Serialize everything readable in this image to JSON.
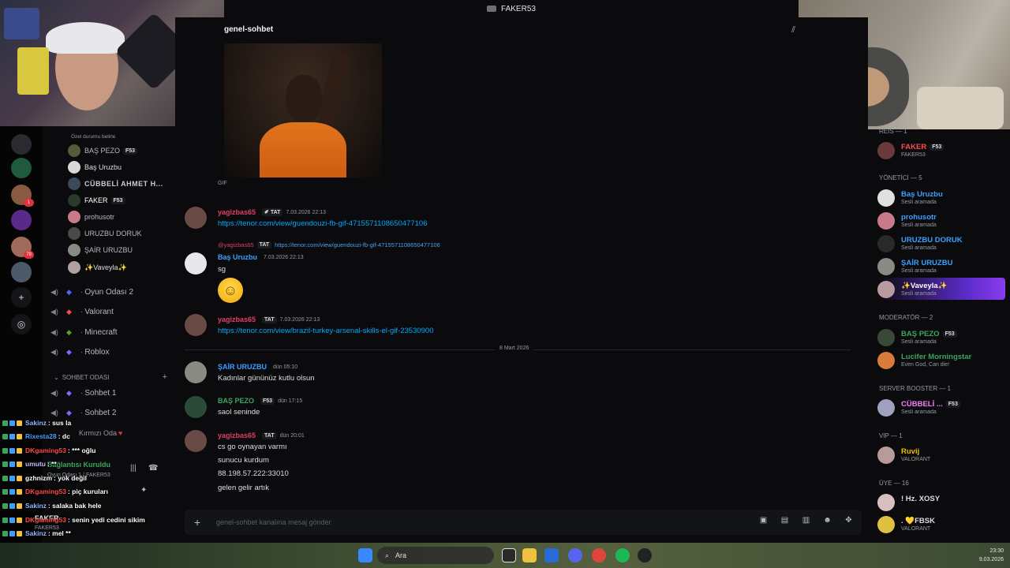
{
  "window": {
    "title": "FAKER53"
  },
  "channel": {
    "name": "genel-sohbet",
    "placeholder": "genel-sohbet kanalına mesaj gönder"
  },
  "voice_users": [
    {
      "name": "BAŞ PEZO",
      "tag": "F53",
      "color": "#b5bac1"
    },
    {
      "name": "Baş Uruzbu",
      "tag": "",
      "color": "#dbdee1"
    },
    {
      "name": "CÜBBELİ AHMET H...",
      "tag": "",
      "color": "#c9ccd2"
    },
    {
      "name": "FAKER",
      "tag": "F53",
      "color": "#ffffff"
    },
    {
      "name": "prohusotr",
      "tag": "",
      "color": "#b5bac1"
    },
    {
      "name": "URUZBU DORUK",
      "tag": "",
      "color": "#b5bac1"
    },
    {
      "name": "ŞAİR URUZBU",
      "tag": "",
      "color": "#b5bac1"
    },
    {
      "name": "✨Vaveyla✨",
      "tag": "",
      "color": "#dbdee1"
    }
  ],
  "voice_channels": [
    {
      "name": "Oyun Odası 2"
    },
    {
      "name": "Valorant"
    },
    {
      "name": "Minecraft"
    },
    {
      "name": "Roblox"
    }
  ],
  "category": {
    "name": "SOHBET ODASI"
  },
  "sohbet_channels": [
    {
      "name": "Sohbet 1"
    },
    {
      "name": "Sohbet 2"
    }
  ],
  "stream_chat": [
    {
      "user": "Sakinz",
      "text": ": sus la",
      "color": "#8fb8ff"
    },
    {
      "user": "Rixesta28",
      "text": ": dc",
      "color": "#4aa0ff"
    },
    {
      "user": "DKgaming53",
      "text": ": *** oğlu",
      "color": "#ff4a4a"
    },
    {
      "user": "umutu",
      "text": ": **",
      "color": "#c8b4ff"
    },
    {
      "user": "gzhnizm",
      "text": ": yok değil",
      "color": "#ffffff"
    },
    {
      "user": "DKgaming53",
      "text": ": piç kuruları",
      "color": "#ff4a4a"
    },
    {
      "user": "Sakinz",
      "text": ": salaka bak hele",
      "color": "#8fb8ff"
    },
    {
      "user": "DKgaming53",
      "text": ": senin yedi cedini sikim",
      "color": "#ff4a4a"
    },
    {
      "user": "Sakinz",
      "text": ": mel **",
      "color": "#8fb8ff"
    }
  ],
  "sidebar_overlay": {
    "status_hint": "Özel durumu belirle",
    "red_room": "Kırmızı Oda",
    "connection": "Bağlantısı Kuruldu",
    "connection_sub": "Oyun Odası 1 / FAKER53",
    "user": "FAKER",
    "user_sub": "FAKER53"
  },
  "gif_label": "GIF",
  "messages": [
    {
      "user": "yagizbas65",
      "tag": "TAT",
      "time": "7.03.2026 22:13",
      "link": "https://tenor.com/view/guendouzi-fb-gif-4715571108650477106"
    },
    {
      "reply_user": "@yagizbas65",
      "reply_tag": "TAT",
      "reply_link": "https://tenor.com/view/guendouzi-fb-gif-4715571108650477106",
      "user": "Baş Uruzbu",
      "time": "7.03.2026 22:13",
      "text": "sg"
    },
    {
      "user": "yagizbas65",
      "tag": "TAT",
      "time": "7.03.2026 22:13",
      "link": "https://tenor.com/view/brazil-turkey-arsenal-skills-el-gif-23530900"
    },
    {
      "user": "ŞAİR URUZBU",
      "time": "dün 05:10",
      "text": "Kadınlar gününüz kutlu olsun"
    },
    {
      "user": "BAŞ PEZO",
      "tag": "F53",
      "time": "dün 17:15",
      "text": "saol seninde"
    },
    {
      "user": "yagizbas65",
      "tag": "TAT",
      "time": "dün 20:01",
      "lines": [
        "cs go oynayan varmı",
        "sunucu kurdum",
        "88.198.57.222:33010",
        "gelen gelir artık"
      ]
    }
  ],
  "date_divider": "8 Mart 2026",
  "members": {
    "reis": {
      "label": "REİS — 1",
      "items": [
        {
          "name": "FAKER",
          "tag": "F53",
          "sub": "FAKER53",
          "color": "#ff4a4a"
        }
      ]
    },
    "yonetici": {
      "label": "YÖNETİCİ — 5",
      "items": [
        {
          "name": "Baş Uruzbu",
          "sub": "Sesli aramada",
          "color": "#3aa0ff"
        },
        {
          "name": "prohusotr",
          "sub": "Sesli aramada",
          "color": "#3aa0ff"
        },
        {
          "name": "URUZBU DORUK",
          "sub": "Sesli aramada",
          "color": "#3aa0ff"
        },
        {
          "name": "ŞAİR URUZBU",
          "sub": "Sesli aramada",
          "color": "#3aa0ff"
        },
        {
          "name": "✨Vaveyla✨",
          "sub": "Sesli aramada",
          "color": "#ffffff"
        }
      ]
    },
    "moderator": {
      "label": "MODERATÖR — 2",
      "items": [
        {
          "name": "BAŞ PEZO",
          "tag": "F53",
          "sub": "Sesli aramada",
          "color": "#3ba55d"
        },
        {
          "name": "Lucifer Morningstar",
          "sub": "Even God, Can die!",
          "color": "#3ba55d"
        }
      ]
    },
    "booster": {
      "label": "Server Booster — 1",
      "items": [
        {
          "name": "CÜBBELİ ...",
          "tag": "F53",
          "sub": "Sesli aramada",
          "color": "#f47fff"
        }
      ]
    },
    "vip": {
      "label": "VIP — 1",
      "items": [
        {
          "name": "Ruvij",
          "sub": "VALORANT",
          "color": "#f0c000"
        }
      ]
    },
    "uye": {
      "label": "Üye — 16",
      "items": [
        {
          "name": "! Hz. XOSY",
          "sub": "",
          "color": "#dbdee1"
        },
        {
          "name": ". 💛FBSK",
          "sub": "VALORANT",
          "color": "#dbdee1"
        }
      ]
    }
  },
  "taskbar": {
    "search_label": "Ara",
    "time": "23:30",
    "date": "9.03.2026"
  },
  "colors": {
    "bg": "#0b0b0d",
    "accent": "#5865f2",
    "link": "#00a8fc"
  }
}
